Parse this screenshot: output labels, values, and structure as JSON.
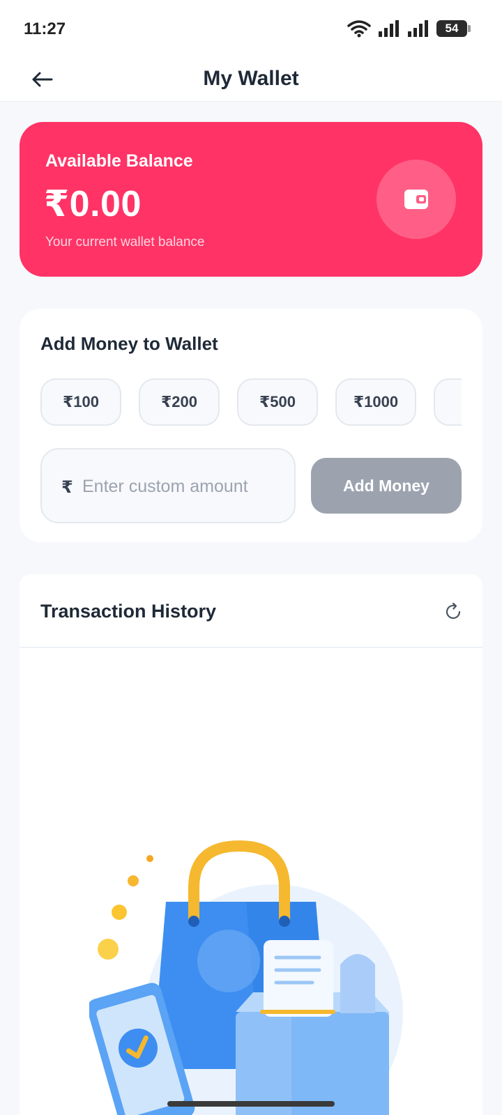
{
  "status_bar": {
    "time": "11:27",
    "battery": "54"
  },
  "header": {
    "title": "My Wallet",
    "back_icon": "arrow-left-icon"
  },
  "balance_card": {
    "label": "Available Balance",
    "amount": "₹0.00",
    "subtitle": "Your current wallet balance",
    "icon": "wallet-icon",
    "color": "#ff3366"
  },
  "add_money": {
    "title": "Add Money to Wallet",
    "presets": [
      "₹100",
      "₹200",
      "₹500",
      "₹1000"
    ],
    "currency_symbol": "₹",
    "input_placeholder": "Enter custom amount",
    "input_value": "",
    "button_label": "Add Money",
    "button_color": "#9ca3af"
  },
  "transactions": {
    "title": "Transaction History",
    "refresh_icon": "refresh-icon",
    "illustration": "empty-shopping-illustration"
  }
}
